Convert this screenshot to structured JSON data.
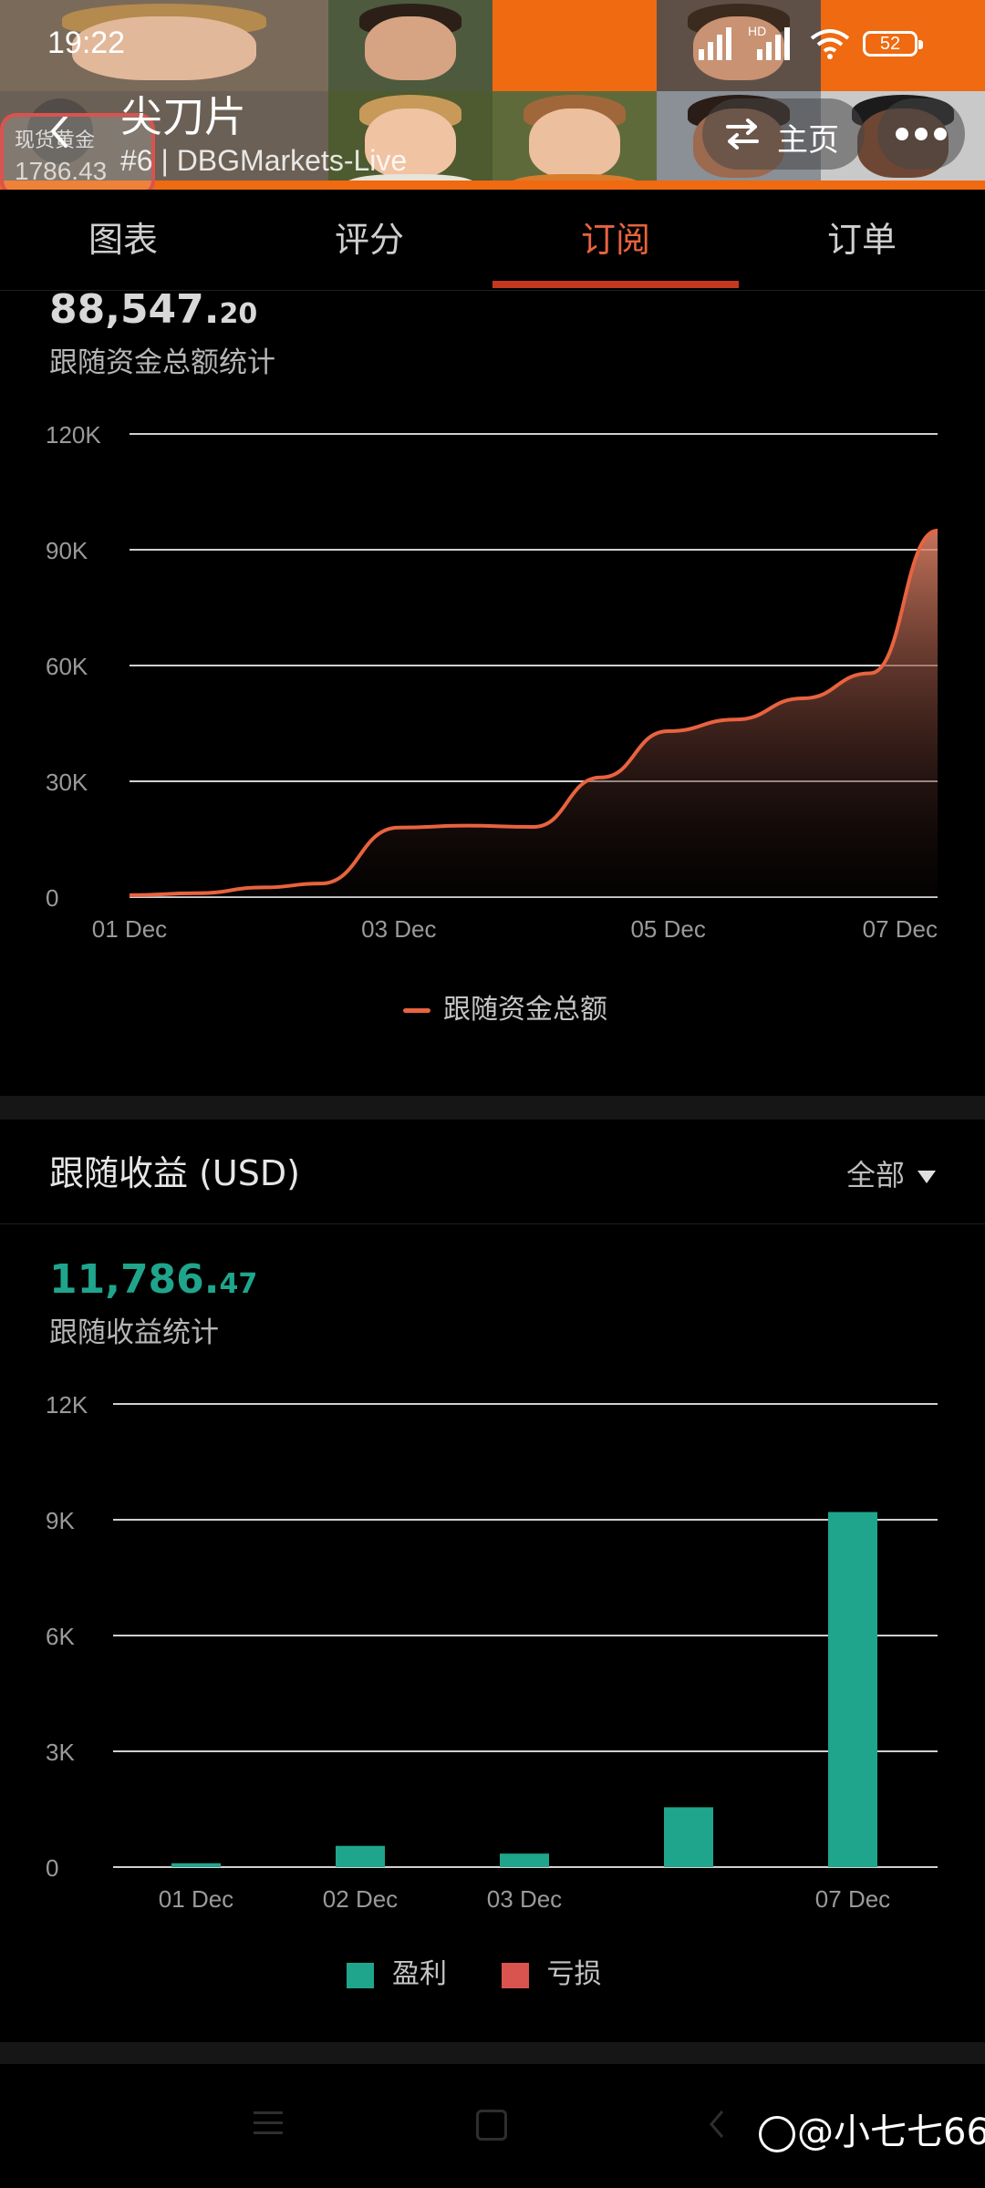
{
  "status_bar": {
    "time": "19:22",
    "network_label": "HD",
    "battery": "52"
  },
  "header": {
    "floating_badge_label": "现货黄金",
    "floating_badge_value": "1786.43",
    "strategy_name": "尖刀片",
    "strategy_sub": "#6 | DBGMarkets-Live",
    "home_button": "主页"
  },
  "tabs": [
    {
      "label": "图表",
      "active": false
    },
    {
      "label": "评分",
      "active": false
    },
    {
      "label": "订阅",
      "active": true
    },
    {
      "label": "订单",
      "active": false
    }
  ],
  "follow_funds": {
    "amount_int": "88,547.",
    "amount_dec": "20",
    "label": "跟随资金总额统计",
    "legend": "跟随资金总额"
  },
  "follow_income": {
    "title": "跟随收益 (USD)",
    "filter": "全部",
    "amount_int": "11,786.",
    "amount_dec": "47",
    "label": "跟随收益统计",
    "legend_profit": "盈利",
    "legend_loss": "亏损"
  },
  "colors": {
    "accent": "#e8633f",
    "tab_underline": "#c4381f",
    "profit": "#1fa58b",
    "loss": "#d9534f"
  },
  "watermark": "@小七七66",
  "chart_data": [
    {
      "type": "area",
      "title": "",
      "series": [
        {
          "name": "跟随资金总额",
          "points": [
            [
              "2022-12-01",
              500
            ],
            [
              "2022-12-01T12:00",
              1000
            ],
            [
              "2022-12-02",
              2500
            ],
            [
              "2022-12-02T10:00",
              3500
            ],
            [
              "2022-12-03",
              18000
            ],
            [
              "2022-12-03T12:00",
              18500
            ],
            [
              "2022-12-04",
              18200
            ],
            [
              "2022-12-04T12:00",
              31000
            ],
            [
              "2022-12-05",
              43000
            ],
            [
              "2022-12-05T12:00",
              46000
            ],
            [
              "2022-12-06",
              51500
            ],
            [
              "2022-12-06T12:00",
              58000
            ],
            [
              "2022-12-07",
              95000
            ]
          ]
        }
      ],
      "x_ticks": [
        "01 Dec",
        "03 Dec",
        "05 Dec",
        "07 Dec"
      ],
      "y_ticks": [
        "0",
        "30K",
        "60K",
        "90K",
        "120K"
      ],
      "ylim": [
        0,
        120000
      ],
      "grid": true,
      "legend_position": "bottom"
    },
    {
      "type": "bar",
      "title": "",
      "categories": [
        "01 Dec",
        "02 Dec",
        "03 Dec",
        "",
        "07 Dec"
      ],
      "series": [
        {
          "name": "盈利",
          "values": [
            100,
            550,
            350,
            1550,
            9200
          ]
        },
        {
          "name": "亏损",
          "values": [
            0,
            0,
            0,
            0,
            0
          ]
        }
      ],
      "y_ticks": [
        "0",
        "3K",
        "6K",
        "9K",
        "12K"
      ],
      "ylim": [
        0,
        12000
      ],
      "grid": true,
      "legend_position": "bottom"
    }
  ]
}
